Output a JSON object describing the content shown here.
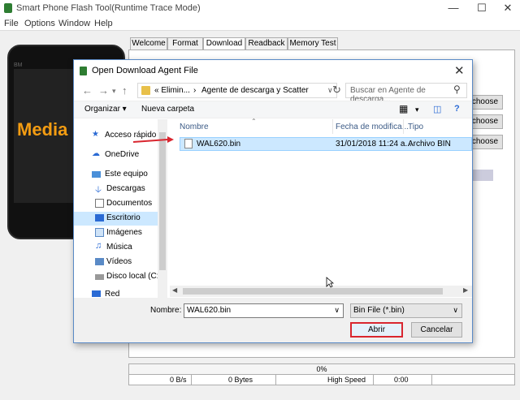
{
  "app": {
    "title": "Smart Phone Flash Tool(Runtime Trace Mode)",
    "menu": [
      "File",
      "Options",
      "Window",
      "Help"
    ],
    "tabs": [
      "Welcome",
      "Format",
      "Download",
      "Readback",
      "Memory Test"
    ],
    "active_tab": "Download",
    "choose_buttons": [
      "choose",
      "choose",
      "choose"
    ],
    "phone_brand": "Media",
    "phone_badge": "BM",
    "progress": "0%",
    "status": {
      "speed": "0 B/s",
      "bytes": "0 Bytes",
      "mode": "High Speed",
      "time": "0:00"
    }
  },
  "dialog": {
    "title": "Open Download Agent File",
    "path_segments": [
      "« Elimin...",
      "›",
      "Agente de descarga y Scatter"
    ],
    "search_placeholder": "Buscar en Agente de descarga...",
    "toolbar": {
      "organize": "Organizar ▾",
      "new_folder": "Nueva carpeta"
    },
    "sidebar": [
      {
        "label": "Acceso rápido",
        "icon": "star-icon"
      },
      {
        "label": "OneDrive",
        "icon": "cloud-icon"
      },
      {
        "label": "Este equipo",
        "icon": "computer-icon"
      },
      {
        "label": "Descargas",
        "icon": "download-arrow-icon"
      },
      {
        "label": "Documentos",
        "icon": "document-icon"
      },
      {
        "label": "Escritorio",
        "icon": "desktop-icon"
      },
      {
        "label": "Imágenes",
        "icon": "image-icon"
      },
      {
        "label": "Música",
        "icon": "music-icon"
      },
      {
        "label": "Vídeos",
        "icon": "video-icon"
      },
      {
        "label": "Disco local (C:)",
        "icon": "drive-icon"
      },
      {
        "label": "Red",
        "icon": "network-icon"
      }
    ],
    "selected_sidebar": "Escritorio",
    "columns": [
      "Nombre",
      "Fecha de modifica...",
      "Tipo"
    ],
    "files": [
      {
        "name": "WAL620.bin",
        "date": "31/01/2018 11:24 a...",
        "type": "Archivo BIN"
      }
    ],
    "filename_label": "Nombre:",
    "filename_value": "WAL620.bin",
    "filetype": "Bin File (*.bin)",
    "open_label": "Abrir",
    "cancel_label": "Cancelar",
    "colors": {
      "highlight": "#cce8ff",
      "callout": "#d9262f"
    }
  }
}
